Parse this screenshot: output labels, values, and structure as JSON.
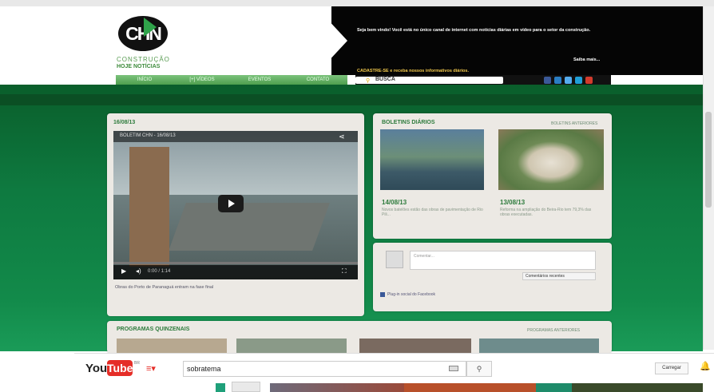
{
  "header": {
    "logo": "CHN",
    "brand_line1": "CONSTRUÇÃO",
    "brand_line2": "HOJE NOTÍCIAS",
    "welcome": "Seja bem vindo! Você está no único canal de internet com notícias diárias em vídeo para o setor da construção.",
    "saiba_mais": "Saiba mais...",
    "cadastre": "CADASTRE-SE e receba nossos informativos diários."
  },
  "nav": {
    "items": [
      "INÍCIO",
      "[+] VÍDEOS",
      "EVENTOS",
      "CONTATO"
    ],
    "busca_label": "BUSCA"
  },
  "social": {
    "colors": [
      "#3b5998",
      "#2a7ec4",
      "#55acee",
      "#1f9fd7",
      "#d23b2d"
    ]
  },
  "video_panel": {
    "date": "16/08/13",
    "video_title": "BOLETIM CHN - 16/08/13",
    "time": "0:00 / 1:14",
    "caption": "Obras do Porto de Paranaguá entram na fase final"
  },
  "boletins": {
    "title": "BOLETINS DIÁRIOS",
    "link": "BOLETINS ANTERIORES",
    "items": [
      {
        "date": "14/08/13",
        "desc": "Novos batelões estão das obras de pavimentação de Rio Pili..."
      },
      {
        "date": "13/08/13",
        "desc": "Reforma na ampliação do Beira-Rio tem 79,3% das obras executadas."
      }
    ]
  },
  "facebook": {
    "placeholder": "Comentar...",
    "sort": "Comentários recentes",
    "plugin": "Plug-in social do Facebook"
  },
  "programas": {
    "title": "PROGRAMAS QUINZENAIS",
    "link": "PROGRAMAS ANTERIORES"
  },
  "youtube": {
    "you": "You",
    "tube": "Tube",
    "region": "BR",
    "search": "sobratema",
    "upload": "Carregar"
  }
}
